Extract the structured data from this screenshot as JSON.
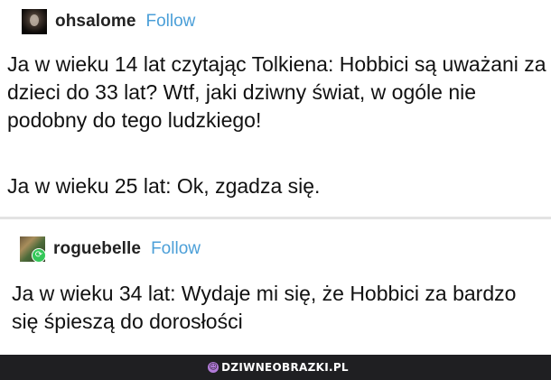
{
  "posts": [
    {
      "username": "ohsalome",
      "follow_label": "Follow",
      "paragraphs": [
        "Ja w wieku 14 lat czytając Tolkiena: Hobbici są uważani za dzieci do 33 lat? Wtf, jaki dziwny świat, w ogóle nie podobny do tego ludzkiego!",
        "Ja w wieku 25 lat: Ok, zgadza się."
      ]
    },
    {
      "username": "roguebelle",
      "follow_label": "Follow",
      "paragraphs": [
        "Ja w wieku 34 lat: Wydaje mi się, że Hobbici za bardzo się śpieszą do dorosłości"
      ]
    }
  ],
  "footer": {
    "brand": "DZIWNEOBRAZKI.PL"
  },
  "icons": {
    "avatar_1": "portrait-avatar-icon",
    "avatar_2": "image-avatar-icon",
    "reblog_badge": "reblog-icon",
    "brand_icon": "brand-logo-icon"
  }
}
